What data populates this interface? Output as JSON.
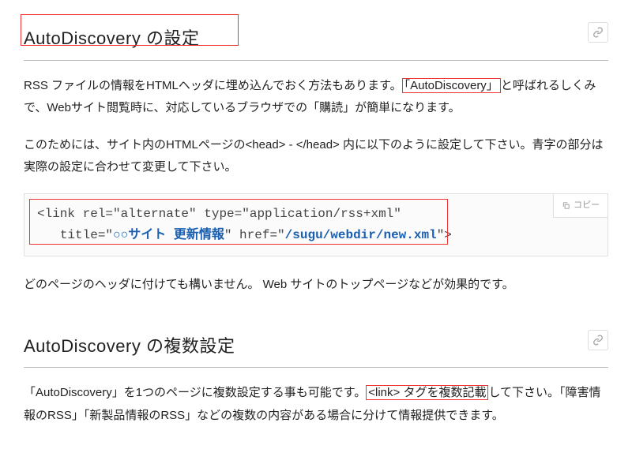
{
  "section1": {
    "title": "AutoDiscovery の設定",
    "p1_a": "RSS ファイルの情報をHTMLヘッダに埋め込んでおく方法もあります。",
    "p1_b_boxed": "「AutoDiscovery」",
    "p1_c": "と呼ばれるしくみで、Webサイト閲覧時に、対応しているブラウザでの「購読」が簡単になります。",
    "p2": "このためには、サイト内のHTMLページの<head> - </head> 内に以下のように設定して下さい。青字の部分は実際の設定に合わせて変更して下さい。",
    "code": {
      "line1_a": "<link rel=\"alternate\" type=\"application/rss+xml\"",
      "line2_a": "   title=\"",
      "line2_blue1": "○○サイト 更新情報",
      "line2_b": "\" href=\"",
      "line2_blue2": "/sugu/webdir/new.xml",
      "line2_c": "\">",
      "copy_label": "コピー"
    },
    "p3": "どのページのヘッダに付けても構いません。 Web サイトのトップページなどが効果的です。"
  },
  "section2": {
    "title": "AutoDiscovery の複数設定",
    "p1_a": "「AutoDiscovery」を1つのページに複数設定する事も可能です。",
    "p1_boxed": "<link> タグを複数記載",
    "p1_b": "して下さい。「障害情報のRSS」「新製品情報のRSS」などの複数の内容がある場合に分けて情報提供できます。"
  }
}
